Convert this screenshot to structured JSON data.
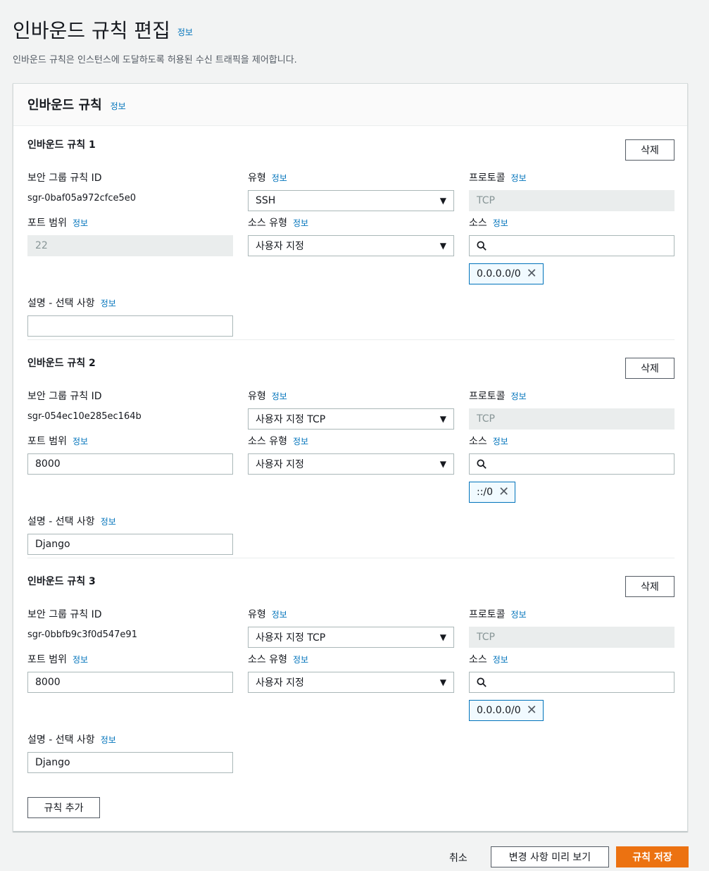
{
  "page": {
    "title": "인바운드 규칙 편집",
    "info": "정보",
    "description": "인바운드 규칙은 인스턴스에 도달하도록 허용된 수신 트래픽을 제어합니다."
  },
  "panel": {
    "title": "인바운드 규칙",
    "info": "정보"
  },
  "labels": {
    "sg_rule_id": "보안 그룹 규칙 ID",
    "type": "유형",
    "protocol": "프로토콜",
    "port_range": "포트 범위",
    "source_type": "소스 유형",
    "source": "소스",
    "description": "설명 - 선택 사항",
    "info": "정보",
    "delete": "삭제"
  },
  "rules": [
    {
      "title": "인바운드 규칙 1",
      "id": "sgr-0baf05a972cfce5e0",
      "type": "SSH",
      "protocol": "TCP",
      "port": "22",
      "source_type": "사용자 지정",
      "source_search": "",
      "source_token": "0.0.0.0/0",
      "description": ""
    },
    {
      "title": "인바운드 규칙 2",
      "id": "sgr-054ec10e285ec164b",
      "type": "사용자 지정 TCP",
      "protocol": "TCP",
      "port": "8000",
      "source_type": "사용자 지정",
      "source_search": "",
      "source_token": "::/0",
      "description": "Django"
    },
    {
      "title": "인바운드 규칙 3",
      "id": "sgr-0bbfb9c3f0d547e91",
      "type": "사용자 지정 TCP",
      "protocol": "TCP",
      "port": "8000",
      "source_type": "사용자 지정",
      "source_search": "",
      "source_token": "0.0.0.0/0",
      "description": "Django"
    }
  ],
  "actions": {
    "add_rule": "규칙 추가",
    "cancel": "취소",
    "preview": "변경 사항 미리 보기",
    "save": "규칙 저장"
  },
  "colors": {
    "accent_link": "#0073bb",
    "primary_button": "#ec7211",
    "background": "#f2f3f3"
  }
}
